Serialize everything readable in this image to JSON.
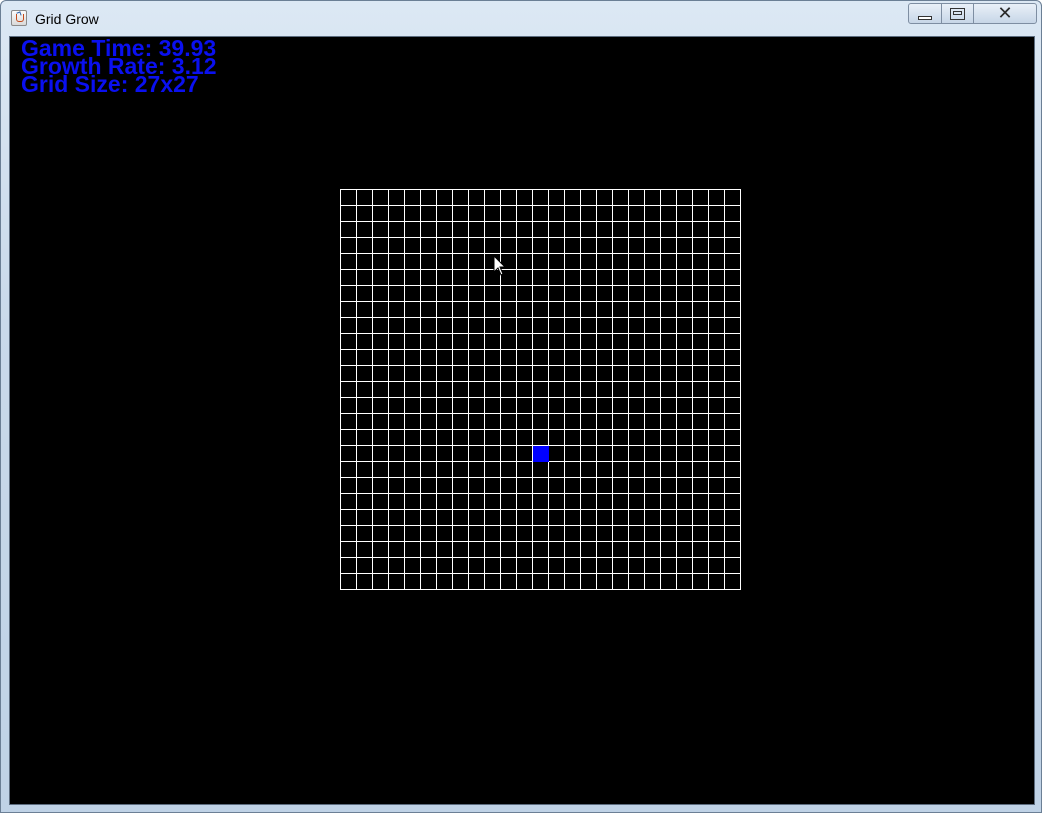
{
  "window": {
    "title": "Grid Grow",
    "icon": "java-app-icon",
    "controls": [
      "minimize",
      "maximize",
      "close"
    ]
  },
  "hud": {
    "game_time": "Game Time: 39.93",
    "growth_rate": "Growth Rate: 3.12",
    "grid_size": "Grid Size: 27x27",
    "color": "#0a10f0"
  },
  "board": {
    "rows": 25,
    "cols": 25,
    "line_color": "#ffffff",
    "background_color": "#000000",
    "player": {
      "row": 16,
      "col": 12,
      "color": "#0000ff"
    }
  }
}
